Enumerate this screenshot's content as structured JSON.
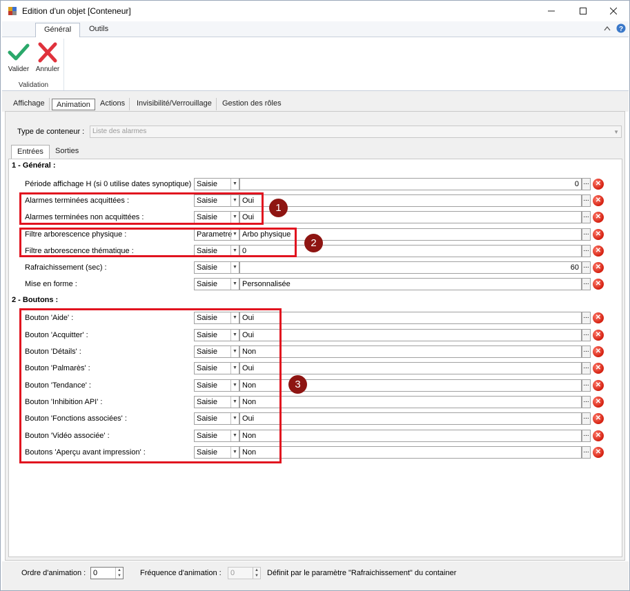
{
  "window": {
    "title": "Edition d'un objet [Conteneur]"
  },
  "ribbon": {
    "tabs": [
      {
        "label": "Général"
      },
      {
        "label": "Outils"
      }
    ],
    "validate_label": "Valider",
    "cancel_label": "Annuler",
    "group_label": "Validation"
  },
  "tabs": [
    {
      "label": "Affichage"
    },
    {
      "label": "Animation"
    },
    {
      "label": "Actions"
    },
    {
      "label": "Invisibilité/Verrouillage"
    },
    {
      "label": "Gestion des rôles"
    }
  ],
  "container_type": {
    "label": "Type de conteneur :",
    "value": "Liste des alarmes"
  },
  "subtabs": [
    {
      "label": "Entrées"
    },
    {
      "label": "Sorties"
    }
  ],
  "sections": [
    {
      "title": "1 - Général :",
      "rows": [
        {
          "label": "Période affichage H (si 0 utilise dates synoptique) :",
          "type": "Saisie",
          "value": "0"
        },
        {
          "label": "Alarmes terminées acquittées :",
          "type": "Saisie",
          "value": "Oui"
        },
        {
          "label": "Alarmes terminées non acquittées :",
          "type": "Saisie",
          "value": "Oui"
        },
        {
          "label": "Filtre arborescence physique :",
          "type": "Parametre",
          "value": "Arbo physique"
        },
        {
          "label": "Filtre arborescence thématique :",
          "type": "Saisie",
          "value": "0"
        },
        {
          "label": "Rafraichissement (sec) :",
          "type": "Saisie",
          "value": "60"
        },
        {
          "label": "Mise en forme :",
          "type": "Saisie",
          "value": "Personnalisée"
        }
      ]
    },
    {
      "title": "2 - Boutons :",
      "rows": [
        {
          "label": "Bouton 'Aide' :",
          "type": "Saisie",
          "value": "Oui"
        },
        {
          "label": "Bouton 'Acquitter' :",
          "type": "Saisie",
          "value": "Oui"
        },
        {
          "label": "Bouton 'Détails' :",
          "type": "Saisie",
          "value": "Non"
        },
        {
          "label": "Bouton 'Palmarès' :",
          "type": "Saisie",
          "value": "Oui"
        },
        {
          "label": "Bouton 'Tendance' :",
          "type": "Saisie",
          "value": "Non"
        },
        {
          "label": "Bouton 'Inhibition API' :",
          "type": "Saisie",
          "value": "Non"
        },
        {
          "label": "Bouton 'Fonctions associées' :",
          "type": "Saisie",
          "value": "Oui"
        },
        {
          "label": "Bouton 'Vidéo associée' :",
          "type": "Saisie",
          "value": "Non"
        },
        {
          "label": "Boutons 'Aperçu avant impression' :",
          "type": "Saisie",
          "value": "Non"
        }
      ]
    }
  ],
  "annotations": [
    {
      "label": "1"
    },
    {
      "label": "2"
    },
    {
      "label": "3"
    }
  ],
  "bottom": {
    "order_label": "Ordre d'animation :",
    "order_value": "0",
    "freq_label": "Fréquence d'animation :",
    "freq_value": "0",
    "freq_note": "Définit par le paramètre \"Rafraichissement\" du container"
  },
  "colors": {
    "highlight": "#e1131f",
    "badge": "#8e1512",
    "validate": "#2aa86a",
    "cancel": "#e0323c"
  }
}
